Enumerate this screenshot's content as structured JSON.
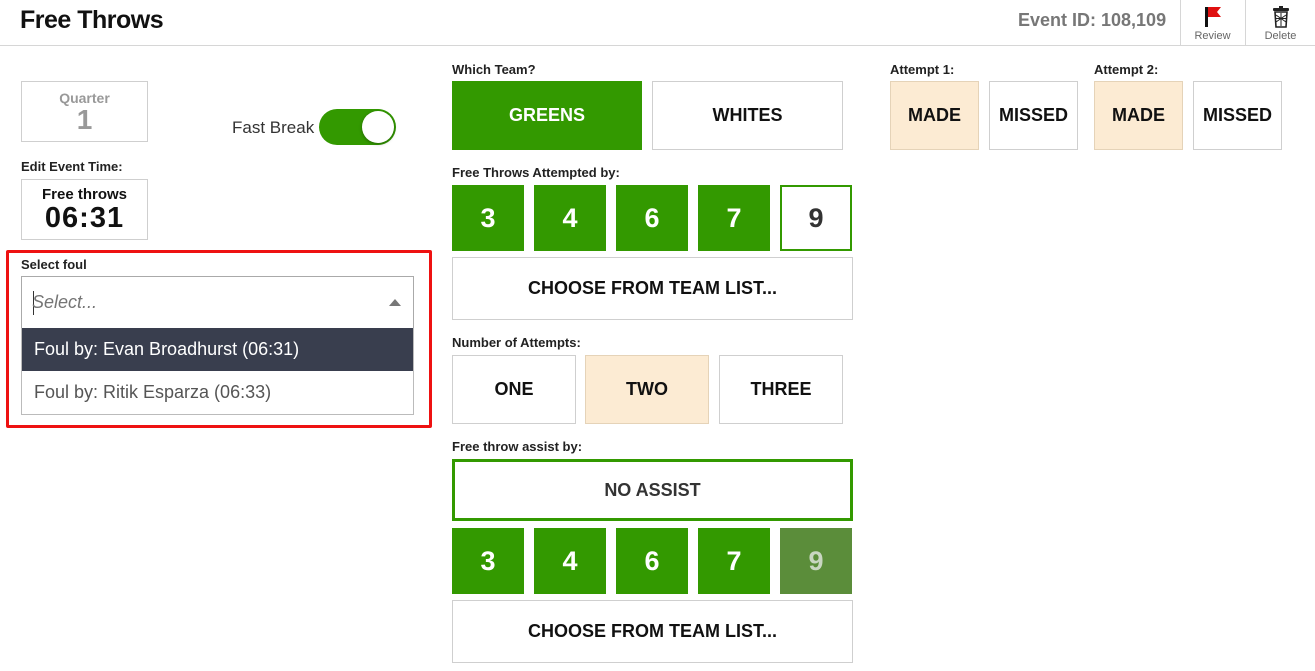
{
  "header": {
    "title": "Free Throws",
    "event_id": "Event ID: 108,109",
    "review_label": "Review",
    "delete_label": "Delete"
  },
  "left": {
    "quarter_label": "Quarter",
    "quarter_value": "1",
    "fast_break_label": "Fast Break",
    "fast_break_on": true,
    "edit_time_label": "Edit Event Time:",
    "event_type": "Free throws",
    "event_time": "06:31",
    "select_foul_label": "Select foul",
    "select_placeholder": "Select...",
    "foul_options": [
      "Foul by: Evan Broadhurst (06:31)",
      "Foul by: Ritik Esparza (06:33)"
    ]
  },
  "middle": {
    "which_team_label": "Which Team?",
    "teams": [
      "GREENS",
      "WHITES"
    ],
    "attempted_by_label": "Free Throws Attempted by:",
    "attempted_numbers": [
      "3",
      "4",
      "6",
      "7",
      "9"
    ],
    "choose_team_list": "CHOOSE FROM TEAM LIST...",
    "num_attempts_label": "Number of Attempts:",
    "attempt_options": [
      "ONE",
      "TWO",
      "THREE"
    ],
    "assist_label": "Free throw assist by:",
    "no_assist": "NO ASSIST",
    "assist_numbers": [
      "3",
      "4",
      "6",
      "7",
      "9"
    ],
    "choose_team_list_2": "CHOOSE FROM TEAM LIST..."
  },
  "right": {
    "attempt1_label": "Attempt 1:",
    "attempt2_label": "Attempt 2:",
    "made": "MADE",
    "missed": "MISSED"
  },
  "colors": {
    "green": "#339900",
    "selected_fill": "#fcebd3",
    "highlight": "#ee1111",
    "dropdown_active": "#393e4e"
  }
}
